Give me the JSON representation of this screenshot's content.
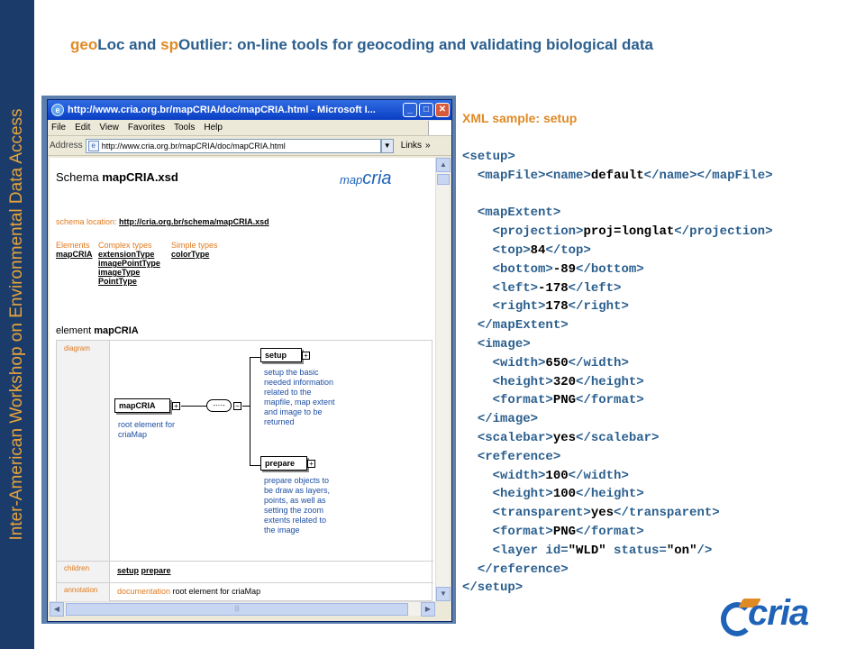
{
  "side_banner": "Inter-American Workshop on Environmental Data Access",
  "title": {
    "part1": "geo",
    "part2": "Loc and ",
    "part3": "sp",
    "part4": "Outlier: on-line tools for geocoding and validating biological data"
  },
  "browser": {
    "window_title": "http://www.cria.org.br/mapCRIA/doc/mapCRIA.html - Microsoft I...",
    "menu": [
      "File",
      "Edit",
      "View",
      "Favorites",
      "Tools",
      "Help"
    ],
    "address_label": "Address",
    "address_value": "http://www.cria.org.br/mapCRIA/doc/mapCRIA.html",
    "links_label": "Links",
    "icons": [
      "ie-icon",
      "minimize-icon",
      "maximize-icon",
      "close-icon",
      "page-icon",
      "chevron-down-icon"
    ]
  },
  "doc": {
    "schema_prefix": "Schema ",
    "schema_name": "mapCRIA.xsd",
    "logo_prefix": "map",
    "logo_main": "cria",
    "schema_location_label": "schema location: ",
    "schema_location_link": "http://cria.org.br/schema/mapCRIA.xsd",
    "columns": [
      {
        "header": "Elements",
        "items": [
          "mapCRIA"
        ]
      },
      {
        "header": "Complex types",
        "items": [
          "extensionType",
          "imagePointType",
          "imageType",
          "PointType"
        ]
      },
      {
        "header": "Simple types",
        "items": [
          "colorType"
        ]
      }
    ],
    "element_prefix": "element ",
    "element_name": "mapCRIA",
    "row_diagram": "diagram",
    "row_children": "children",
    "row_annotation": "annotation",
    "diagram": {
      "root": "mapCRIA",
      "root_desc": [
        "root element for",
        "criaMap"
      ],
      "setup": "setup",
      "setup_desc": [
        "setup the basic",
        "needed information",
        "related to the",
        "mapfile, map extent",
        "and image to be",
        "returned"
      ],
      "prepare": "prepare",
      "prepare_desc": [
        "prepare objects to",
        "be draw as layers,",
        "points, as well as",
        "setting the zoom",
        "extents related to",
        "the image"
      ]
    },
    "children": [
      "setup",
      "prepare"
    ],
    "annotation_label": "documentation",
    "annotation_text": " root element for criaMap"
  },
  "xml_title": "XML sample: setup",
  "xml_lines": [
    {
      "indent": "",
      "parts": [
        [
          "t",
          "<setup>"
        ]
      ]
    },
    {
      "indent": "  ",
      "parts": [
        [
          "t",
          "<mapFile>"
        ],
        [
          "t",
          "<name>"
        ],
        [
          "v",
          "default"
        ],
        [
          "t",
          "</name>"
        ],
        [
          "t",
          "</mapFile>"
        ]
      ]
    },
    {
      "indent": "",
      "parts": []
    },
    {
      "indent": "  ",
      "parts": [
        [
          "t",
          "<mapExtent>"
        ]
      ]
    },
    {
      "indent": "    ",
      "parts": [
        [
          "t",
          "<projection>"
        ],
        [
          "v",
          "proj=longlat"
        ],
        [
          "t",
          "</projection>"
        ]
      ]
    },
    {
      "indent": "    ",
      "parts": [
        [
          "t",
          "<top>"
        ],
        [
          "v",
          "84"
        ],
        [
          "t",
          "</top>"
        ]
      ]
    },
    {
      "indent": "    ",
      "parts": [
        [
          "t",
          "<bottom>"
        ],
        [
          "v",
          "-89"
        ],
        [
          "t",
          "</bottom>"
        ]
      ]
    },
    {
      "indent": "    ",
      "parts": [
        [
          "t",
          "<left>"
        ],
        [
          "v",
          "-178"
        ],
        [
          "t",
          "</left>"
        ]
      ]
    },
    {
      "indent": "    ",
      "parts": [
        [
          "t",
          "<right>"
        ],
        [
          "v",
          "178"
        ],
        [
          "t",
          "</right>"
        ]
      ]
    },
    {
      "indent": "  ",
      "parts": [
        [
          "t",
          "</mapExtent>"
        ]
      ]
    },
    {
      "indent": "  ",
      "parts": [
        [
          "t",
          "<image>"
        ]
      ]
    },
    {
      "indent": "    ",
      "parts": [
        [
          "t",
          "<width>"
        ],
        [
          "v",
          "650"
        ],
        [
          "t",
          "</width>"
        ]
      ]
    },
    {
      "indent": "    ",
      "parts": [
        [
          "t",
          "<height>"
        ],
        [
          "v",
          "320"
        ],
        [
          "t",
          "</height>"
        ]
      ]
    },
    {
      "indent": "    ",
      "parts": [
        [
          "t",
          "<format>"
        ],
        [
          "v",
          "PNG"
        ],
        [
          "t",
          "</format>"
        ]
      ]
    },
    {
      "indent": "  ",
      "parts": [
        [
          "t",
          "</image>"
        ]
      ]
    },
    {
      "indent": "  ",
      "parts": [
        [
          "t",
          "<scalebar>"
        ],
        [
          "v",
          "yes"
        ],
        [
          "t",
          "</scalebar>"
        ]
      ]
    },
    {
      "indent": "  ",
      "parts": [
        [
          "t",
          "<reference>"
        ]
      ]
    },
    {
      "indent": "    ",
      "parts": [
        [
          "t",
          "<width>"
        ],
        [
          "v",
          "100"
        ],
        [
          "t",
          "</width>"
        ]
      ]
    },
    {
      "indent": "    ",
      "parts": [
        [
          "t",
          "<height>"
        ],
        [
          "v",
          "100"
        ],
        [
          "t",
          "</height>"
        ]
      ]
    },
    {
      "indent": "    ",
      "parts": [
        [
          "t",
          "<transparent>"
        ],
        [
          "v",
          "yes"
        ],
        [
          "t",
          "</transparent>"
        ]
      ]
    },
    {
      "indent": "    ",
      "parts": [
        [
          "t",
          "<format>"
        ],
        [
          "v",
          "PNG"
        ],
        [
          "t",
          "</format>"
        ]
      ]
    },
    {
      "indent": "    ",
      "parts": [
        [
          "t",
          "<layer id="
        ],
        [
          "v",
          "\"WLD\""
        ],
        [
          "t",
          " status="
        ],
        [
          "v",
          "\"on\""
        ],
        [
          "t",
          "/>"
        ]
      ]
    },
    {
      "indent": "  ",
      "parts": [
        [
          "t",
          "</reference>"
        ]
      ]
    },
    {
      "indent": "",
      "parts": [
        [
          "t",
          "</setup>"
        ]
      ]
    }
  ],
  "footer_logo": "cria",
  "colors": {
    "banner": "#1b3c6b",
    "accent_orange": "#e08a25",
    "accent_blue": "#2b5f8e"
  }
}
